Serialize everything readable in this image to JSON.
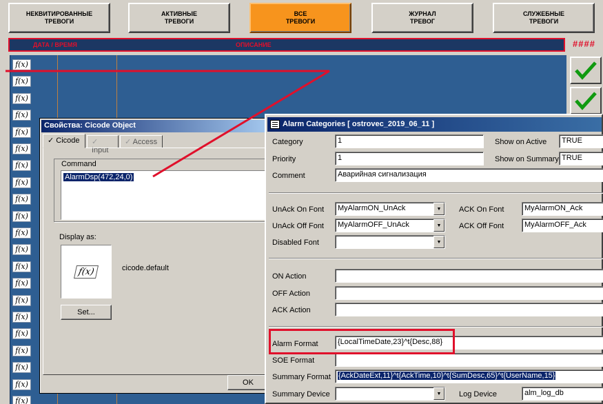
{
  "nav": {
    "buttons": [
      {
        "label": "НЕКВИТИРОВАННЫЕ\nТРЕВОГИ"
      },
      {
        "label": "АКТИВНЫЕ\nТРЕВОГИ"
      },
      {
        "label": "ВСЕ\nТРЕВОГИ"
      },
      {
        "label": "ЖУРНАЛ\nТРЕВОГ"
      },
      {
        "label": "СЛУЖЕБНЫЕ\nТРЕВОГИ"
      }
    ]
  },
  "header": {
    "col_datetime": "ДАТА / ВРЕМЯ",
    "col_desc": "ОПИСАНИЕ",
    "overflow": "####"
  },
  "grid": {
    "fx_label": "f(x)"
  },
  "cicode_dialog": {
    "title": "Свойства: Cicode Object",
    "tabs": [
      "Cicode",
      "Input",
      "Access"
    ],
    "command_label": "Command",
    "command_value": "AlarmDsp(472,24,0)",
    "display_as_label": "Display as:",
    "icon_name": "cicode.default",
    "set_button": "Set...",
    "ok_button": "OK",
    "fx_label": "f(x)"
  },
  "alarm_dialog": {
    "title": "Alarm Categories [ ostrovec_2019_06_11 ]",
    "category_label": "Category",
    "category_value": "1",
    "priority_label": "Priority",
    "priority_value": "1",
    "show_active_label": "Show on Active",
    "show_active_value": "TRUE",
    "show_summary_label": "Show on Summary",
    "show_summary_value": "TRUE",
    "comment_label": "Comment",
    "comment_value": "Аварийная сигнализация",
    "unack_on_label": "UnAck On Font",
    "unack_on_value": "MyAlarmON_UnAck",
    "ack_on_label": "ACK On Font",
    "ack_on_value": "MyAlarmON_Ack",
    "unack_off_label": "UnAck Off Font",
    "unack_off_value": "MyAlarmOFF_UnAck",
    "ack_off_label": "ACK Off Font",
    "ack_off_value": "MyAlarmOFF_Ack",
    "disabled_label": "Disabled Font",
    "disabled_value": "",
    "on_action_label": "ON Action",
    "off_action_label": "OFF Action",
    "ack_action_label": "ACK Action",
    "alarm_format_label": "Alarm Format",
    "alarm_format_value": "{LocalTimeDate,23}^t{Desc,88}",
    "soe_format_label": "SOE Format",
    "summary_format_label": "Summary Format",
    "summary_format_value": "{AckDateExt,11}^t{AckTime,10}^t{SumDesc,65}^t{UserName,15}",
    "summary_device_label": "Summary Device",
    "log_device_label": "Log Device",
    "log_device_value": "alm_log_db"
  },
  "colors": {
    "accent_active": "#f7941d",
    "grid_bg": "#2e5e92",
    "header_bg": "#1c3763",
    "annotation_red": "#e0102b"
  }
}
